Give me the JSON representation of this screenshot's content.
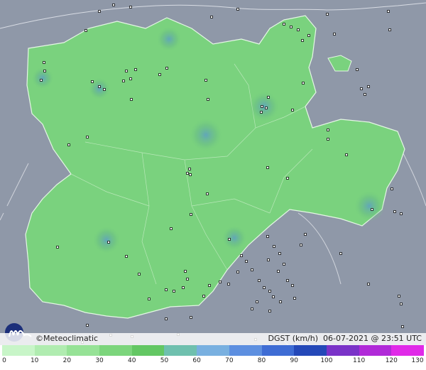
{
  "brand": {
    "name": "©Meteoclimatic"
  },
  "product": {
    "variable": "DGST (km/h)",
    "date": "06-07-2021",
    "at": "@",
    "time": "23:51 UTC"
  },
  "legend": {
    "ticks": [
      "0",
      "10",
      "20",
      "30",
      "40",
      "50",
      "60",
      "70",
      "80",
      "90",
      "100",
      "110",
      "120",
      "130"
    ],
    "colors": [
      "#c8f5c8",
      "#b0ecb0",
      "#96e296",
      "#7cd57c",
      "#63c763",
      "#6fc0ae",
      "#79b0e0",
      "#5d8fe0",
      "#3e6cd4",
      "#2448b8",
      "#7a33c8",
      "#b02ad8",
      "#e02ae8",
      "#ff66ff"
    ]
  },
  "colors": {
    "land": "#78d27c",
    "region": "#82d983",
    "sea_and_outside": "#8f98a8"
  },
  "stations": [
    [
      160,
      7
    ],
    [
      184,
      10
    ],
    [
      140,
      16
    ],
    [
      121,
      43
    ],
    [
      62,
      88
    ],
    [
      63,
      100
    ],
    [
      58,
      113
    ],
    [
      140,
      122
    ],
    [
      147,
      126
    ],
    [
      191,
      98
    ],
    [
      178,
      100
    ],
    [
      184,
      111
    ],
    [
      174,
      114
    ],
    [
      185,
      140
    ],
    [
      225,
      105
    ],
    [
      235,
      96
    ],
    [
      290,
      113
    ],
    [
      293,
      140
    ],
    [
      369,
      150
    ],
    [
      368,
      158
    ],
    [
      375,
      152
    ],
    [
      378,
      137
    ],
    [
      412,
      155
    ],
    [
      427,
      117
    ],
    [
      420,
      42
    ],
    [
      410,
      38
    ],
    [
      435,
      50
    ],
    [
      426,
      57
    ],
    [
      400,
      34
    ],
    [
      298,
      24
    ],
    [
      335,
      13
    ],
    [
      130,
      115
    ],
    [
      123,
      193
    ],
    [
      97,
      204
    ],
    [
      267,
      238
    ],
    [
      264,
      244
    ],
    [
      268,
      246
    ],
    [
      377,
      236
    ],
    [
      405,
      251
    ],
    [
      462,
      183
    ],
    [
      462,
      196
    ],
    [
      509,
      125
    ],
    [
      519,
      122
    ],
    [
      514,
      133
    ],
    [
      488,
      218
    ],
    [
      292,
      273
    ],
    [
      269,
      302
    ],
    [
      241,
      322
    ],
    [
      323,
      337
    ],
    [
      81,
      348
    ],
    [
      153,
      341
    ],
    [
      178,
      361
    ],
    [
      261,
      382
    ],
    [
      234,
      408
    ],
    [
      245,
      410
    ],
    [
      258,
      405
    ],
    [
      210,
      421
    ],
    [
      123,
      458
    ],
    [
      116,
      482
    ],
    [
      186,
      474
    ],
    [
      251,
      471
    ],
    [
      269,
      447
    ],
    [
      287,
      417
    ],
    [
      295,
      402
    ],
    [
      310,
      397
    ],
    [
      322,
      400
    ],
    [
      335,
      383
    ],
    [
      347,
      368
    ],
    [
      340,
      360
    ],
    [
      355,
      380
    ],
    [
      365,
      395
    ],
    [
      372,
      405
    ],
    [
      380,
      410
    ],
    [
      385,
      418
    ],
    [
      395,
      425
    ],
    [
      362,
      425
    ],
    [
      355,
      435
    ],
    [
      412,
      402
    ],
    [
      415,
      420
    ],
    [
      424,
      345
    ],
    [
      430,
      330
    ],
    [
      480,
      357
    ],
    [
      524,
      295
    ],
    [
      552,
      266
    ],
    [
      556,
      298
    ],
    [
      565,
      301
    ],
    [
      562,
      417
    ],
    [
      565,
      428
    ],
    [
      567,
      460
    ],
    [
      461,
      20
    ],
    [
      547,
      16
    ],
    [
      549,
      42
    ],
    [
      519,
      400
    ],
    [
      394,
      357
    ],
    [
      386,
      347
    ],
    [
      377,
      333
    ],
    [
      378,
      366
    ],
    [
      392,
      382
    ],
    [
      400,
      372
    ],
    [
      405,
      395
    ],
    [
      380,
      438
    ],
    [
      360,
      478
    ],
    [
      325,
      502
    ],
    [
      264,
      393
    ],
    [
      196,
      386
    ],
    [
      234,
      449
    ],
    [
      156,
      472
    ],
    [
      471,
      48
    ],
    [
      503,
      98
    ]
  ]
}
